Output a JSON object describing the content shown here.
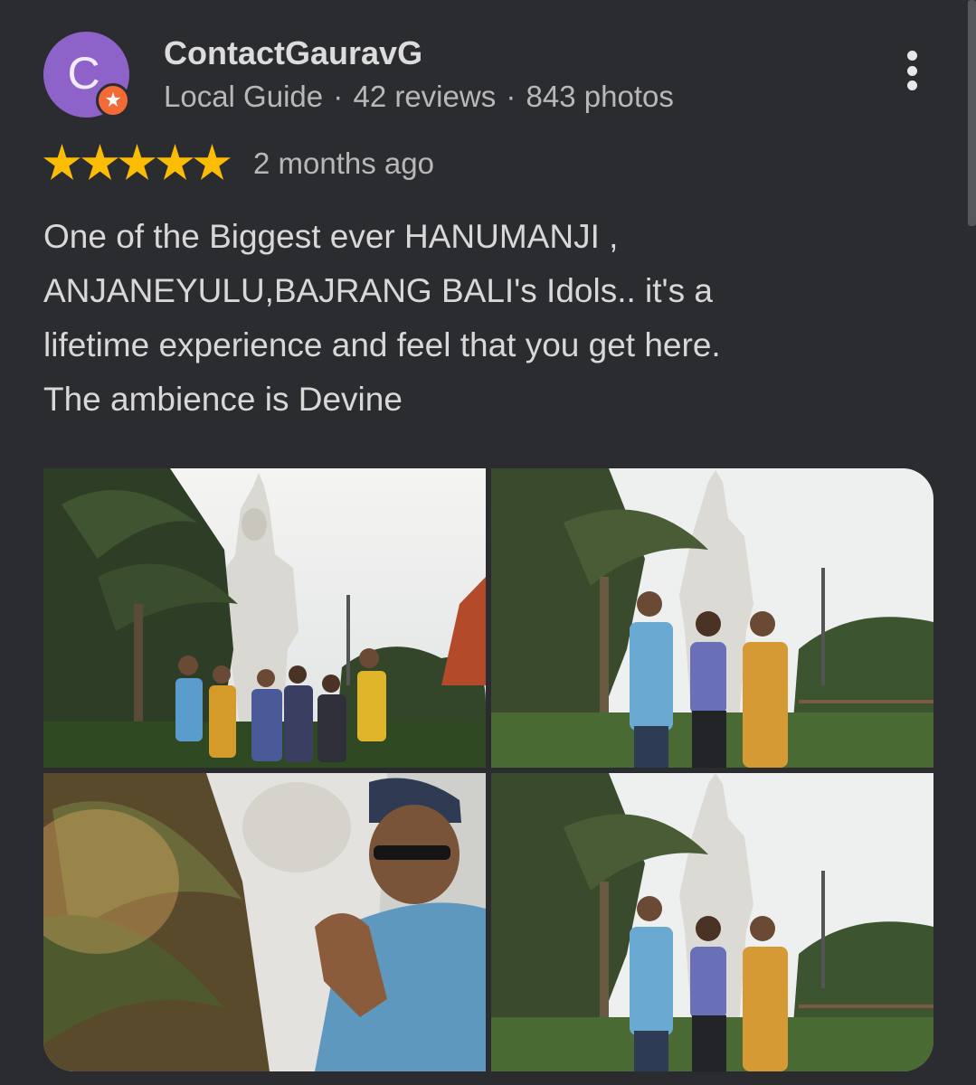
{
  "review": {
    "avatar_letter": "C",
    "reviewer_name": "ContactGauravG",
    "badge": "Local Guide",
    "separator": "·",
    "review_count": "42 reviews",
    "photo_count": "843 photos",
    "rating": 5,
    "date": "2 months ago",
    "text_lines": [
      "One of the Biggest ever HANUMANJI ,",
      "ANJANEYULU,BAJRANG BALI's Idols.. it's a",
      "lifetime experience and feel that you get here.",
      "The ambience is Devine"
    ]
  },
  "icons": {
    "menu": "more-vert-icon",
    "star": "star-icon",
    "badge": "local-guide-star-icon"
  },
  "colors": {
    "background": "#2b2c30",
    "avatar": "#8e63c9",
    "badge": "#f26a36",
    "star": "#fbbc04",
    "text": "#d8d8d8",
    "secondary_text": "#b8b8b8"
  },
  "photos": [
    {
      "subject": "group-photo-statue"
    },
    {
      "subject": "family-photo-statue"
    },
    {
      "subject": "man-namaste-statue"
    },
    {
      "subject": "family-photo-statue"
    }
  ]
}
